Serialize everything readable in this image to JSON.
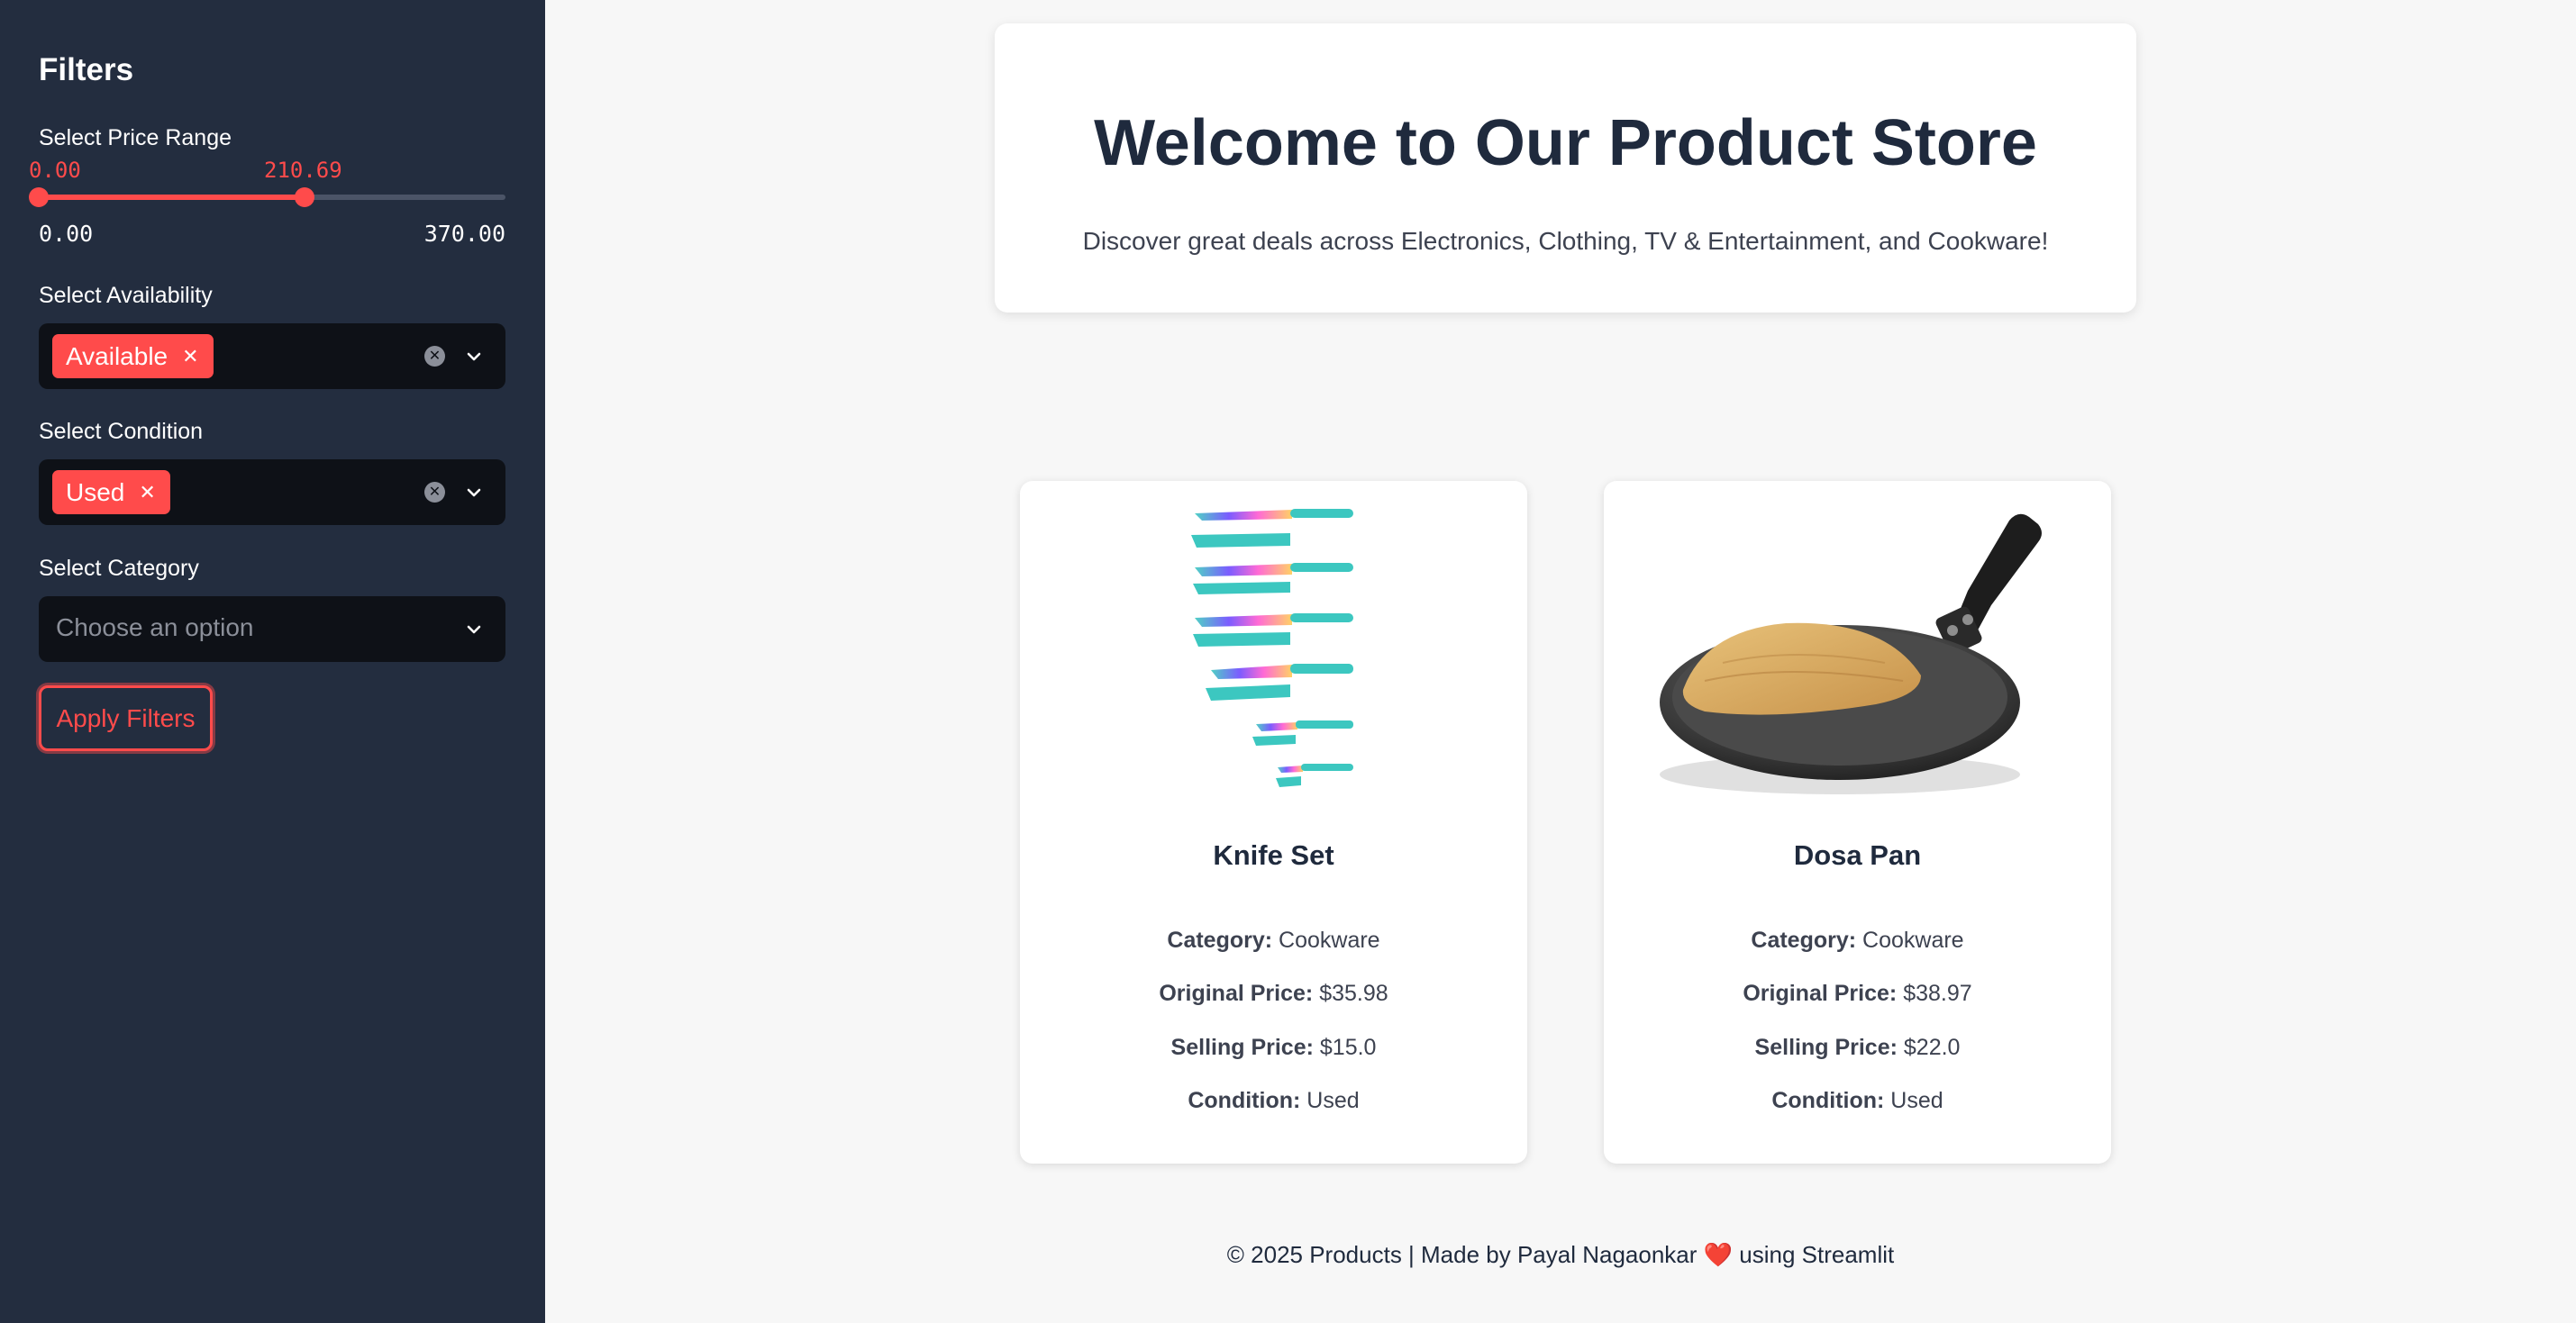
{
  "sidebar": {
    "title": "Filters",
    "price": {
      "label": "Select Price Range",
      "low_value": "0.00",
      "high_value": "210.69",
      "min": "0.00",
      "max": "370.00",
      "fill_fraction": 0.5694
    },
    "availability": {
      "label": "Select Availability",
      "selected": "Available",
      "remove_glyph": "✕",
      "clear_glyph": "✕"
    },
    "condition": {
      "label": "Select Condition",
      "selected": "Used",
      "remove_glyph": "✕",
      "clear_glyph": "✕"
    },
    "category": {
      "label": "Select Category",
      "placeholder": "Choose an option"
    },
    "apply_label": "Apply Filters"
  },
  "hero": {
    "title": "Welcome to Our Product Store",
    "subtitle": "Discover great deals across Electronics, Clothing, TV & Entertainment, and Cookware!"
  },
  "products": [
    {
      "name": "Knife Set",
      "category_label": "Category:",
      "category": "Cookware",
      "original_label": "Original Price:",
      "original_price": "$35.98",
      "selling_label": "Selling Price:",
      "selling_price": "$15.0",
      "condition_label": "Condition:",
      "condition": "Used",
      "image_icon": "knife-set-image"
    },
    {
      "name": "Dosa Pan",
      "category_label": "Category:",
      "category": "Cookware",
      "original_label": "Original Price:",
      "original_price": "$38.97",
      "selling_label": "Selling Price:",
      "selling_price": "$22.0",
      "condition_label": "Condition:",
      "condition": "Used",
      "image_icon": "dosa-pan-image"
    }
  ],
  "footer": {
    "left": "© 2025 Products | Made by Payal Nagaonkar",
    "heart": "❤️",
    "right": "using Streamlit"
  },
  "colors": {
    "sidebar_bg": "#232d3f",
    "accent": "#ff4b4b",
    "select_bg": "#0e1117",
    "main_bg": "#f7f7f7"
  }
}
